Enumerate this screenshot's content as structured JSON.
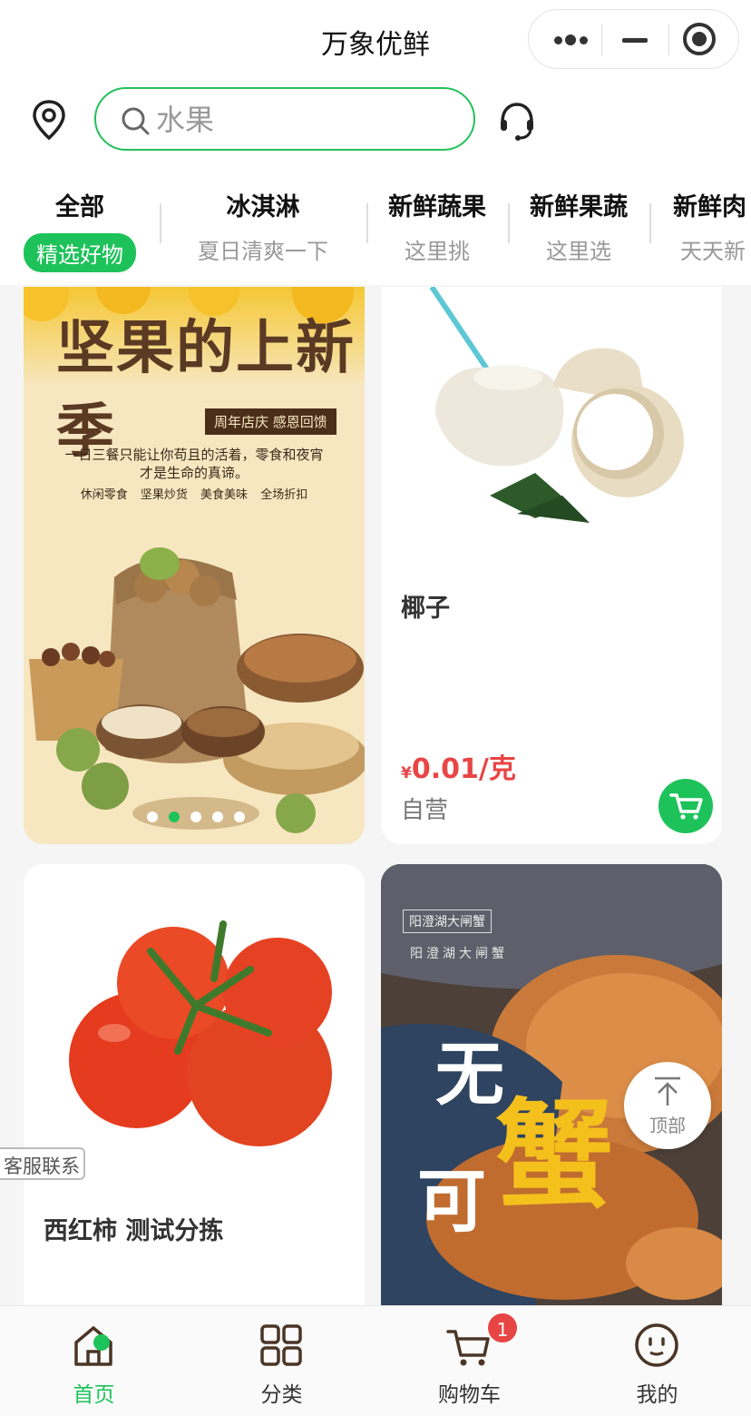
{
  "app": {
    "title": "万象优鲜"
  },
  "search": {
    "placeholder": "水果"
  },
  "categories": [
    {
      "name": "全部",
      "sub": "精选好物",
      "active": true
    },
    {
      "name": "冰淇淋",
      "sub": "夏日清爽一下"
    },
    {
      "name": "新鲜蔬果",
      "sub": "这里挑"
    },
    {
      "name": "新鲜果蔬",
      "sub": "这里选"
    },
    {
      "name": "新鲜肉",
      "sub": "天天新"
    }
  ],
  "banner": {
    "title": "坚果的上新季",
    "tag": "周年店庆  感恩回馈",
    "line1": "一日三餐只能让你苟且的活着，零食和夜宵",
    "line2": "才是生命的真谛。",
    "keywords": "休闲零食 坚果炒货 美食美味 全场折扣",
    "dots": 5,
    "active_dot": 1
  },
  "products": [
    {
      "name": "椰子",
      "yen": "¥",
      "price": "0.01/克",
      "shop": "自营"
    },
    {
      "name": "西红柿 测试分拣"
    }
  ],
  "crab_ad": {
    "small1": "阳澄湖大闸蟹",
    "small2": "阳澄湖大闸蟹",
    "wu": "无",
    "xie": "蟹",
    "ke": "可"
  },
  "to_top": {
    "label": "顶部"
  },
  "customer_service": {
    "label": "客服联系"
  },
  "tabbar": [
    {
      "label": "首页",
      "icon": "home-icon",
      "active": true
    },
    {
      "label": "分类",
      "icon": "grid-icon"
    },
    {
      "label": "购物车",
      "icon": "cart-icon",
      "badge": "1"
    },
    {
      "label": "我的",
      "icon": "profile-icon"
    }
  ],
  "colors": {
    "accent": "#1ec25a",
    "price": "#e84545",
    "badge": "#e84545"
  }
}
